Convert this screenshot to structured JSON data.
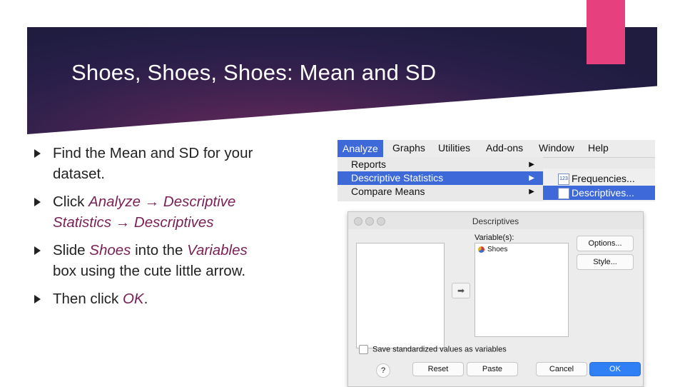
{
  "slide": {
    "title": "Shoes, Shoes, Shoes: Mean and SD",
    "bullets": [
      {
        "line1_plain": "Find the Mean and SD for your",
        "line2_plain": "dataset."
      },
      {
        "lead": "Click ",
        "em1": "Analyze → Descriptive",
        "em2": "Statistics → Descriptives"
      },
      {
        "lead": "Slide ",
        "em1": "Shoes",
        "mid": " into the ",
        "em2": "Variables",
        "line2_plain": "box using the cute little arrow."
      },
      {
        "lead": "Then click ",
        "em1": "OK",
        "tail": "."
      }
    ],
    "colors": {
      "banner": "#2a1f4a",
      "accent_pink": "#e6407f",
      "emphasis": "#7a2255"
    }
  },
  "menu": {
    "bar": [
      "Analyze",
      "Graphs",
      "Utilities",
      "Add-ons",
      "Window",
      "Help"
    ],
    "items": [
      "Reports",
      "Descriptive Statistics",
      "Compare Means"
    ],
    "submenu": [
      "Frequencies...",
      "Descriptives..."
    ]
  },
  "dialog": {
    "title": "Descriptives",
    "variables_label": "Variable(s):",
    "variable_item": "Shoes",
    "options_button": "Options...",
    "style_button": "Style...",
    "save_checkbox": "Save standardized values as variables",
    "help": "?",
    "reset": "Reset",
    "paste": "Paste",
    "cancel": "Cancel",
    "ok": "OK"
  }
}
